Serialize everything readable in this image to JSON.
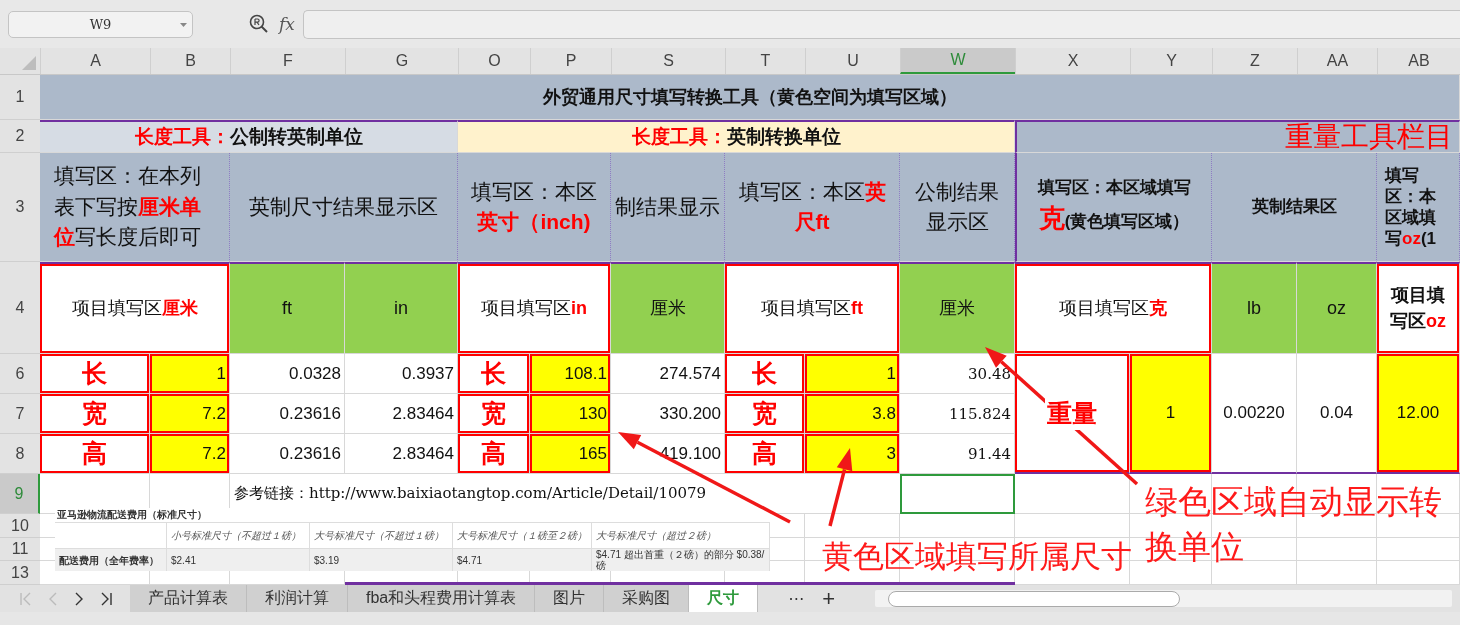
{
  "name_box": "W9",
  "formula_label": "fx",
  "columns": [
    {
      "label": "A",
      "selected": false
    },
    {
      "label": "B",
      "selected": false
    },
    {
      "label": "F",
      "selected": false
    },
    {
      "label": "G",
      "selected": false
    },
    {
      "label": "O",
      "selected": false
    },
    {
      "label": "P",
      "selected": false
    },
    {
      "label": "S",
      "selected": false
    },
    {
      "label": "T",
      "selected": false
    },
    {
      "label": "U",
      "selected": false
    },
    {
      "label": "W",
      "selected": true
    },
    {
      "label": "X",
      "selected": false
    },
    {
      "label": "Y",
      "selected": false
    },
    {
      "label": "Z",
      "selected": false
    },
    {
      "label": "AA",
      "selected": false
    },
    {
      "label": "AB",
      "selected": false
    }
  ],
  "rows": [
    {
      "label": "1",
      "selected": false
    },
    {
      "label": "2",
      "selected": false
    },
    {
      "label": "3",
      "selected": false
    },
    {
      "label": "4",
      "selected": false
    },
    {
      "label": "6",
      "selected": false
    },
    {
      "label": "7",
      "selected": false
    },
    {
      "label": "8",
      "selected": false
    },
    {
      "label": "9",
      "selected": true
    },
    {
      "label": "10",
      "selected": false
    },
    {
      "label": "11",
      "selected": false
    },
    {
      "label": "13",
      "selected": false
    }
  ],
  "title": "外贸通用尺寸填写转换工具（黄色空间为填写区域）",
  "sections": [
    {
      "heading": [
        {
          "text": "长度工具：",
          "highlight": true
        },
        {
          "text": "公制转英制单位",
          "highlight": false
        }
      ]
    },
    {
      "heading": [
        {
          "text": "长度工具：",
          "highlight": true
        },
        {
          "text": "英制转换单位",
          "highlight": false
        }
      ]
    }
  ],
  "weight_heading": "重量工具栏目",
  "row3": [
    {
      "bold": false,
      "segments": [
        {
          "text": "填写区：在本列表下写按",
          "highlight": false
        },
        {
          "text": "厘米单位",
          "highlight": true
        },
        {
          "text": "写长度后即可",
          "highlight": false
        }
      ]
    },
    {
      "bold": false,
      "segments": [
        {
          "text": "英制尺寸结果显示区",
          "highlight": false
        }
      ]
    },
    {
      "bold": false,
      "segments": [
        {
          "text": "填写区：本区",
          "highlight": false
        },
        {
          "text": "英寸（inch)",
          "highlight": true
        }
      ]
    },
    {
      "bold": false,
      "segments": [
        {
          "text": "制结果显示",
          "highlight": false
        }
      ]
    },
    {
      "bold": false,
      "segments": [
        {
          "text": "填写区：本区",
          "highlight": false
        },
        {
          "text": "英尺ft",
          "highlight": true
        }
      ]
    },
    {
      "bold": false,
      "segments": [
        {
          "text": "公制结果显示区",
          "highlight": false
        }
      ]
    },
    {
      "bold": true,
      "segments": [
        {
          "text": "填写区：本区域填写",
          "highlight": false
        },
        {
          "text": "克",
          "highlight": true
        },
        {
          "text": "(黄色填写区域）",
          "highlight": false
        }
      ]
    },
    {
      "bold": true,
      "segments": [
        {
          "text": "英制结果区",
          "highlight": false
        }
      ]
    },
    {
      "bold": true,
      "segments": [
        {
          "text": "填写区：本区域填写",
          "highlight": false
        },
        {
          "text": "oz",
          "highlight": true
        },
        {
          "text": "(1",
          "highlight": false
        }
      ]
    }
  ],
  "row4": [
    {
      "bold": false,
      "segments": [
        {
          "text": "项目填写区",
          "highlight": false
        },
        {
          "text": "厘米",
          "highlight": true
        }
      ]
    },
    {
      "bold": false,
      "segments": [
        {
          "text": "ft",
          "highlight": false
        }
      ]
    },
    {
      "bold": false,
      "segments": [
        {
          "text": "in",
          "highlight": false
        }
      ]
    },
    {
      "bold": false,
      "segments": [
        {
          "text": "项目填写区",
          "highlight": false
        },
        {
          "text": "in",
          "highlight": true
        }
      ]
    },
    {
      "bold": false,
      "segments": [
        {
          "text": "厘米",
          "highlight": false
        }
      ]
    },
    {
      "bold": false,
      "segments": [
        {
          "text": "项目填写区",
          "highlight": false
        },
        {
          "text": "ft",
          "highlight": true
        }
      ]
    },
    {
      "bold": false,
      "segments": [
        {
          "text": "厘米",
          "highlight": false
        }
      ]
    },
    {
      "bold": false,
      "segments": [
        {
          "text": "项目填写区",
          "highlight": false
        },
        {
          "text": "克",
          "highlight": true
        }
      ]
    },
    {
      "bold": false,
      "segments": [
        {
          "text": "lb",
          "highlight": false
        }
      ]
    },
    {
      "bold": false,
      "segments": [
        {
          "text": "oz",
          "highlight": false
        }
      ]
    },
    {
      "bold": true,
      "segments": [
        {
          "text": "项目填写区",
          "highlight": false
        },
        {
          "text": "oz",
          "highlight": true
        }
      ]
    }
  ],
  "metric_to_imperial": [
    {
      "label": "长",
      "cm": "1",
      "ft": "0.0328",
      "in": "0.3937"
    },
    {
      "label": "宽",
      "cm": "7.2",
      "ft": "0.23616",
      "in": "2.83464"
    },
    {
      "label": "高",
      "cm": "7.2",
      "ft": "0.23616",
      "in": "2.83464"
    }
  ],
  "inch_to_cm": [
    {
      "label": "长",
      "inch": "108.1",
      "cm": "274.574"
    },
    {
      "label": "宽",
      "inch": "130",
      "cm": "330.200"
    },
    {
      "label": "高",
      "inch": "165",
      "cm": "419.100"
    }
  ],
  "ft_to_cm": [
    {
      "label": "长",
      "ft": "1",
      "cm": "30.48"
    },
    {
      "label": "宽",
      "ft": "3.8",
      "cm": "115.824"
    },
    {
      "label": "高",
      "ft": "3",
      "cm": "91.44"
    }
  ],
  "weight": {
    "label": "重量",
    "grams": "1",
    "lb": "0.00220",
    "oz": "0.04",
    "oz_input": "12.00"
  },
  "reference_link": "参考链接：http://www.baixiaotangtop.com/Article/Detail/10079",
  "fee_table": {
    "title": "亚马逊物流配送费用（标准尺寸）",
    "columns": [
      "小号标准尺寸（不超过１磅）",
      "大号标准尺寸（不超过１磅）",
      "大号标准尺寸（１磅至２磅）",
      "大号标准尺寸（超过２磅）"
    ],
    "row_label": "配送费用（全年费率）",
    "values": [
      "$2.41",
      "$3.19",
      "$4.71",
      "$4.71 超出首重（２磅）的部分 $0.38/磅"
    ]
  },
  "annotations": [
    "黄色区域填写所属尺寸",
    "绿色区域自动显示转换单位"
  ],
  "sheet_tabs": [
    {
      "label": "产品计算表",
      "selected": false
    },
    {
      "label": "利润计算",
      "selected": false
    },
    {
      "label": "fba和头程费用计算表",
      "selected": false
    },
    {
      "label": "图片",
      "selected": false
    },
    {
      "label": "采购图",
      "selected": false
    },
    {
      "label": "尺寸",
      "selected": true
    }
  ],
  "tab_more": "⋯",
  "tab_add": "+"
}
